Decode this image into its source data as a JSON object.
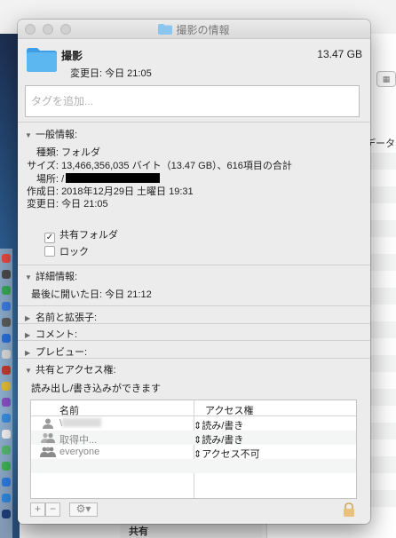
{
  "window": {
    "title": "撮影の情報"
  },
  "header": {
    "name": "撮影",
    "size": "13.47 GB",
    "modified_label": "変更日:",
    "modified_value": "今日 21:05"
  },
  "tags": {
    "placeholder": "タグを追加..."
  },
  "general": {
    "title": "一般情報:",
    "kind_label": "種類:",
    "kind_value": "フォルダ",
    "size_label": "サイズ:",
    "size_value": "13,466,356,035 バイト（13.47 GB）、616項目の合計",
    "where_label": "場所:",
    "where_value": "/",
    "created_label": "作成日:",
    "created_value": "2018年12月29日 土曜日 19:31",
    "modified_label": "変更日:",
    "modified_value": "今日 21:05",
    "shared_folder_label": "共有フォルダ",
    "shared_folder_checked": true,
    "locked_label": "ロック",
    "locked_checked": false
  },
  "more_info": {
    "title": "詳細情報:",
    "last_opened": "最後に開いた日: 今日 21:12"
  },
  "sections": {
    "name_ext": "名前と拡張子:",
    "comments": "コメント:",
    "preview": "プレビュー:",
    "sharing": "共有とアクセス権:"
  },
  "sharing": {
    "description": "読み出し/書き込みができます",
    "col_name": "名前",
    "col_privilege": "アクセス権",
    "rows": [
      {
        "name": "\\",
        "privilege": "読み/書き"
      },
      {
        "name": "取得中...",
        "privilege": "読み/書き"
      },
      {
        "name": "everyone",
        "privilege": "アクセス不可"
      }
    ]
  },
  "background": {
    "column_header": "データ",
    "bottom_label": "共有"
  },
  "colors": {
    "folder_blue": "#43a6e8",
    "panel_bg": "#ececec"
  }
}
